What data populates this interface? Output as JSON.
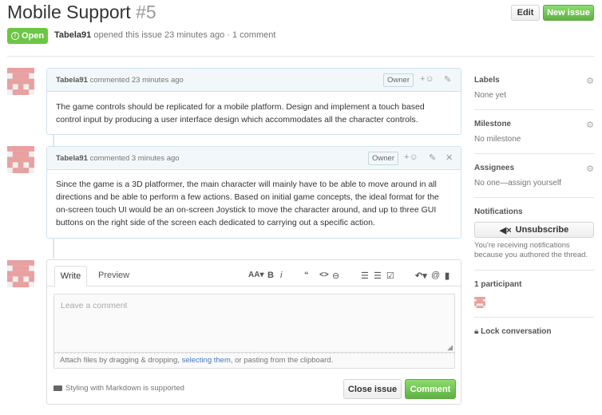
{
  "issue": {
    "title": "Mobile Support",
    "number": "#5",
    "state": "Open",
    "author": "Tabela91",
    "opened_text": "opened this issue 23 minutes ago · 1 comment"
  },
  "header_buttons": {
    "edit": "Edit",
    "new_issue": "New issue"
  },
  "comments": [
    {
      "author": "Tabela91",
      "time": "commented 23 minutes ago",
      "badge": "Owner",
      "body": "The game controls should be replicated for a mobile platform. Design and implement a touch based control input by producing a user interface design which accommodates all the character controls."
    },
    {
      "author": "Tabela91",
      "time": "commented 3 minutes ago",
      "badge": "Owner",
      "body": "Since the game is a 3D platformer, the main character will mainly have to be able to move around in all directions and be able to perform a few actions. Based on initial game concepts, the ideal format for the on-screen touch UI would be an on-screen Joystick to move the character around, and up to three GUI buttons on the right side of the screen each dedicated to carrying out a specific action."
    }
  ],
  "editor": {
    "tab_write": "Write",
    "tab_preview": "Preview",
    "toolbar": {
      "heading": "AA",
      "bold": "B",
      "italic": "i",
      "quote": "❝",
      "code": "<>",
      "link": "🔗",
      "ul": "☰",
      "ol": "☰",
      "task": "☑",
      "reply": "↶",
      "mention": "@",
      "bookmark": "🔖"
    },
    "placeholder": "Leave a comment",
    "attach_before": "Attach files by dragging & dropping, ",
    "attach_link": "selecting them",
    "attach_after": ", or pasting from the clipboard.",
    "markdown_note": "Styling with Markdown is supported",
    "close_issue": "Close issue",
    "comment": "Comment"
  },
  "sidebar": {
    "labels_title": "Labels",
    "labels_value": "None yet",
    "milestone_title": "Milestone",
    "milestone_value": "No milestone",
    "assignees_title": "Assignees",
    "assignees_value": "No one—assign yourself",
    "notifications_title": "Notifications",
    "unsubscribe": "Unsubscribe",
    "notif_note": "You're receiving notifications because you authored the thread.",
    "participants_title": "1 participant",
    "lock": "Lock conversation"
  },
  "colors": {
    "accent_green": "#6cc644",
    "link_blue": "#4078c0",
    "avatar_pink": "#e8a0a0"
  }
}
